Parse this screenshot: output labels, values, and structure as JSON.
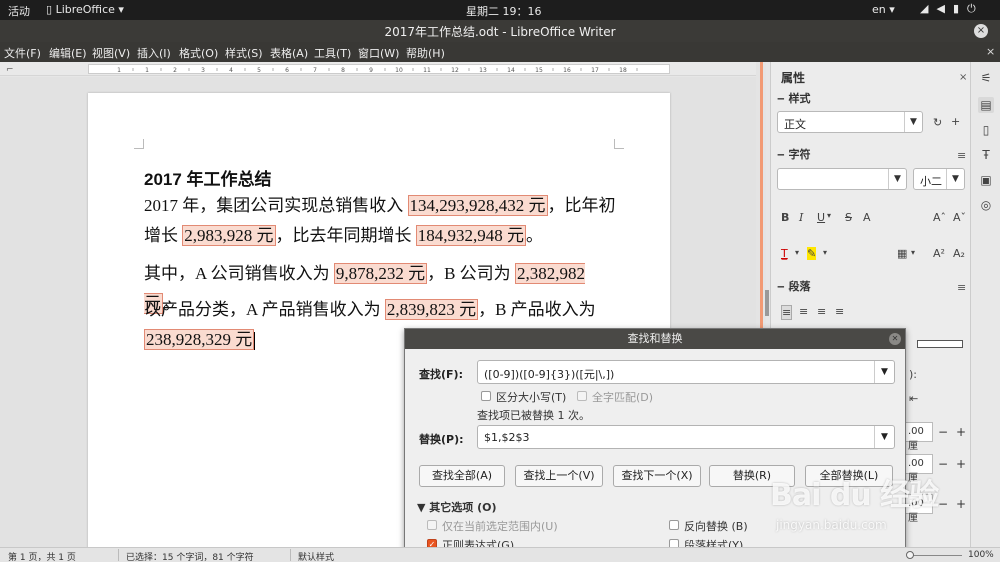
{
  "topbar": {
    "activities": "活动",
    "app_name": "LibreOffice ▾",
    "clock": "星期二 19：16",
    "lang": "en ▾",
    "sys_icons": [
      "wifi-icon",
      "volume-icon",
      "battery-icon",
      "power-icon"
    ]
  },
  "window": {
    "title": "2017年工作总结.odt - LibreOffice Writer",
    "close": "×"
  },
  "menu": {
    "items": [
      "文件(F)",
      "编辑(E)",
      "视图(V)",
      "插入(I)",
      "格式(O)",
      "样式(S)",
      "表格(A)",
      "工具(T)",
      "窗口(W)",
      "帮助(H)"
    ],
    "close": "×"
  },
  "ruler": {
    "ticks": [
      "1",
      "1",
      "2",
      "3",
      "4",
      "5",
      "6",
      "7",
      "8",
      "9",
      "10",
      "11",
      "12",
      "13",
      "14",
      "15",
      "16",
      "17",
      "18"
    ]
  },
  "document": {
    "heading": "2017 年工作总结",
    "p1": {
      "t1": "2017 年，集团公司实现总销售收入 ",
      "h1": "134,293,928,432 元",
      "t2": "，比年初增长 ",
      "h2": "2,983,928 元",
      "t3": "，比去年同期增长 ",
      "h3": "184,932,948 元",
      "t4": "。"
    },
    "p2": {
      "t1": "其中，A 公司销售收入为 ",
      "h1": "9,878,232 元",
      "t2": "，B 公司为 ",
      "h2": "2,382,982 元",
      "t3": "。"
    },
    "p3": {
      "t1": "以产品分类，A 产品销售收入为 ",
      "h1": "2,839,823 元",
      "t2": "，B 产品收入为 ",
      "h2": "238,928,329 元"
    }
  },
  "sidebar": {
    "title": "属性",
    "close": "×",
    "styles_header": "样式",
    "style_value": "正文",
    "char_header": "字符",
    "font_name": "",
    "font_size": "小二",
    "para_header": "段落",
    "spacing_values": [
      ".00 厘",
      ".00 厘",
      ".00 厘"
    ],
    "partial_label": "):"
  },
  "dialog": {
    "title": "查找和替换",
    "find_label": "查找(F):",
    "find_value": "([0-9])([0-9]{3})([元|\\,])",
    "match_case": "区分大小写(T)",
    "whole_words": "全字匹配(D)",
    "note": "查找项已被替换 1 次。",
    "replace_label": "替换(P):",
    "replace_value": "$1,$2$3",
    "buttons": {
      "find_all": "查找全部(A)",
      "find_prev": "查找上一个(V)",
      "find_next": "查找下一个(X)",
      "replace": "替换(R)",
      "replace_all": "全部替换(L)"
    },
    "other_options": "其它选项 (O)",
    "current_selection": "仅在当前选定范围内(U)",
    "backwards": "反向替换 (B)",
    "regex": "正则表达式(G)",
    "para_styles": "段落样式(Y)"
  },
  "status": {
    "page": "第 1 页，共 1 页",
    "selection": "已选择：15 个字词，81 个字符",
    "style": "默认样式",
    "zoom": "100%"
  },
  "watermark": {
    "brand": "Bai du 经验",
    "url": "jingyan.baidu.com"
  },
  "colors": {
    "highlight_fill": "#fadbd0",
    "highlight_border": "#e28a74",
    "ubuntu_orange": "#e95420",
    "sidebar_accent": "#f29a74"
  }
}
